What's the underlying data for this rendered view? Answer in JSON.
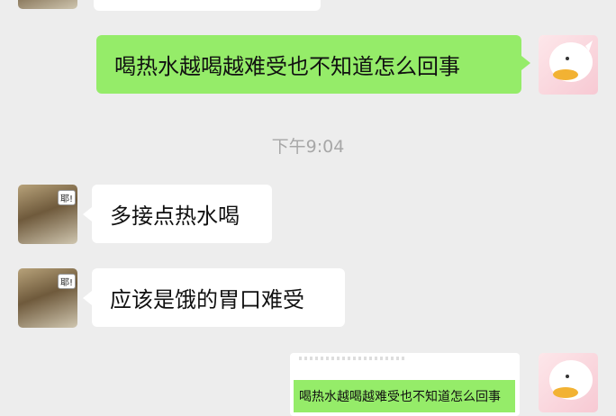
{
  "time_stamp": "下午9:04",
  "messages": {
    "m1": "喝热水越喝越难受也不知道怎么回事",
    "m2": "多接点热水喝",
    "m3": "应该是饿的胃口难受",
    "m4": "喝热水越喝越难受也不知道怎么回事"
  },
  "sticker_label": "耶!",
  "colors": {
    "background": "#ededed",
    "bubble_sent": "#95ec69",
    "bubble_received": "#ffffff",
    "timestamp": "#a7a7a7"
  }
}
